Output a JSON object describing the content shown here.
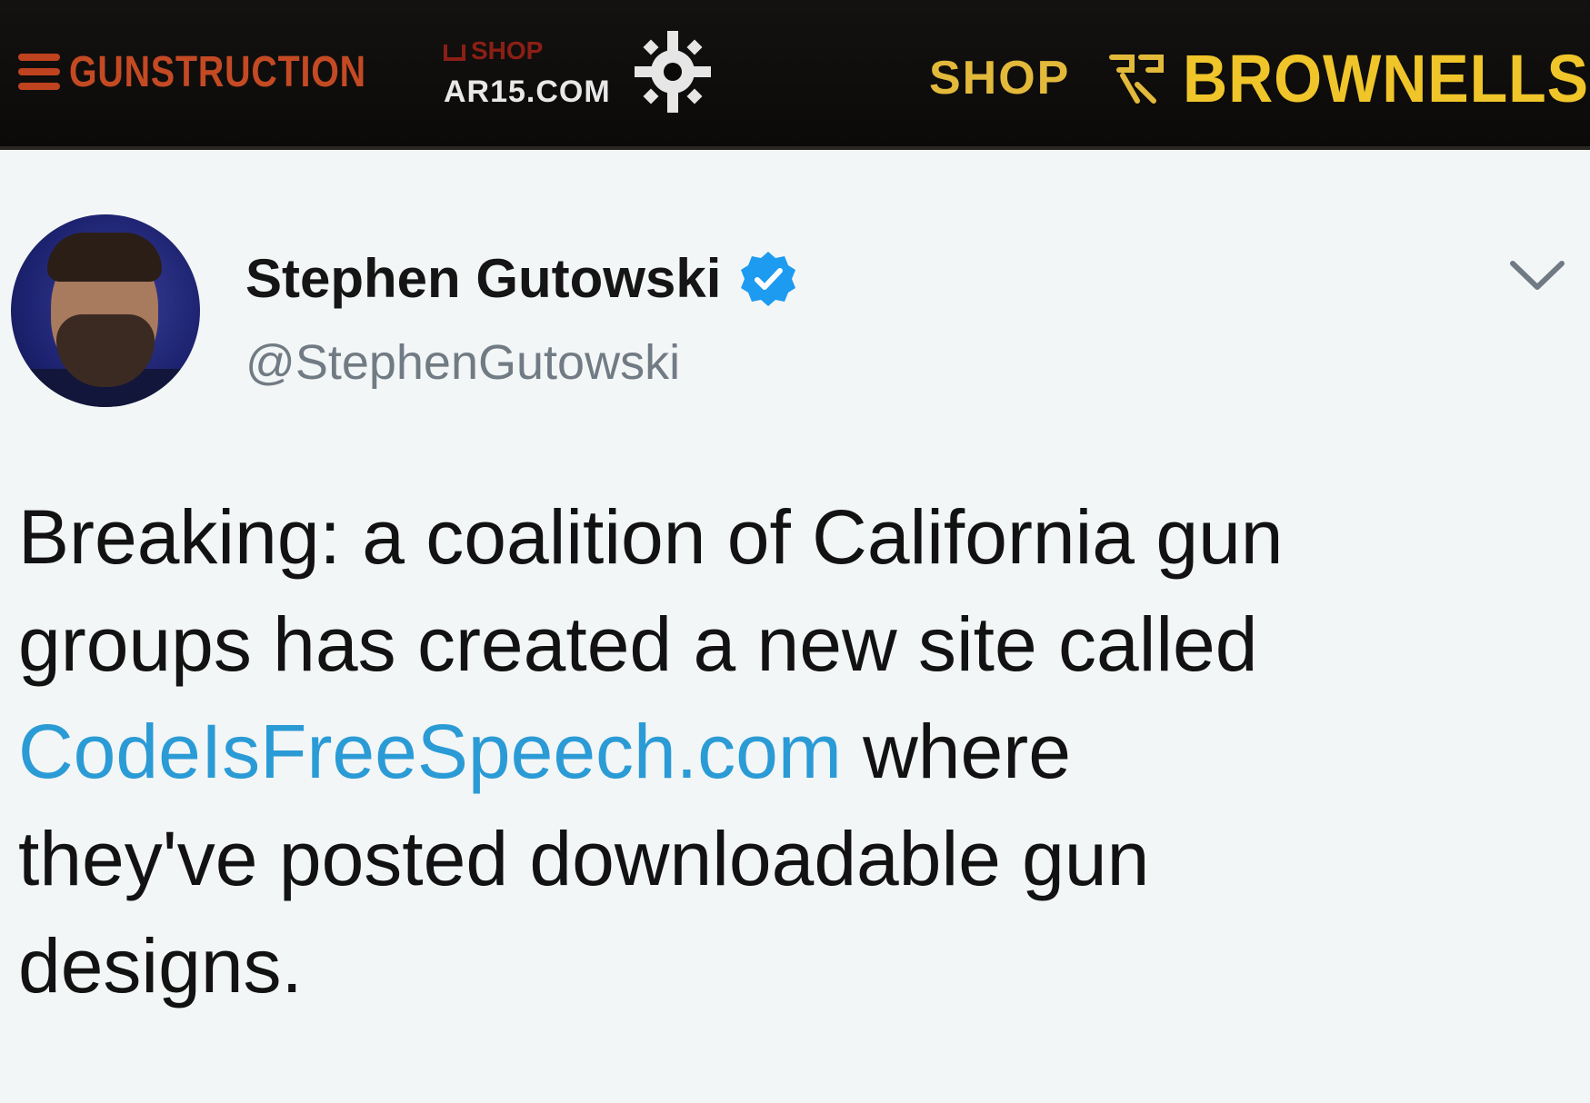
{
  "banner": {
    "gunstruction_logo": "GUNSTRUCTION",
    "ar15_shop": "SHOP",
    "ar15_domain": "AR15.COM",
    "shop_label": "SHOP",
    "brownells": "BROWNELLS",
    "colors": {
      "gunstruction": "#c44a24",
      "brownells": "#f0c52a",
      "ar15_shop": "#8c1f15"
    }
  },
  "tweet": {
    "display_name": "Stephen Gutowski",
    "handle": "@StephenGutowski",
    "verified": true,
    "text_lines": [
      "Breaking: a coalition of California gun",
      "groups has created a new site called"
    ],
    "link_text": "CodeIsFreeSpeech.com",
    "text_after_link": " where",
    "text_lines_2": [
      "they've posted downloadable gun",
      "designs."
    ],
    "colors": {
      "link": "#2b9bd6",
      "verified": "#1d9bf0"
    },
    "icons": {
      "verified": "verified-badge-icon",
      "menu": "chevron-down-icon"
    }
  }
}
